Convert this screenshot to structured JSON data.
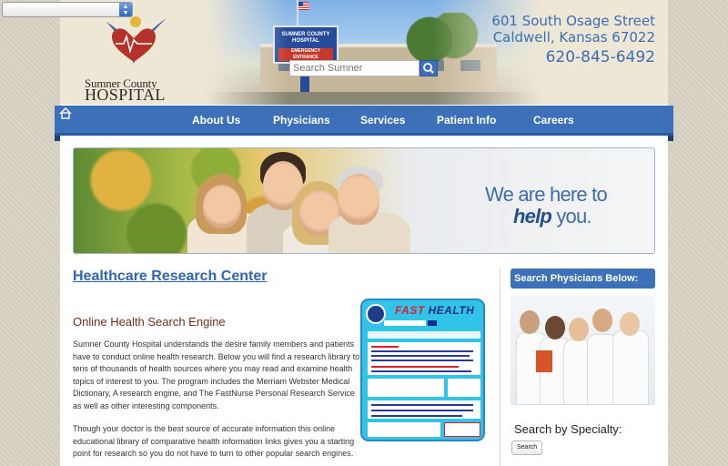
{
  "language_select": {
    "value": ""
  },
  "header": {
    "logo_line1": "Sumner County",
    "logo_line2": "HOSPITAL",
    "search_placeholder": "Search Sumner",
    "sign_title": "SUMNER COUNTY HOSPITAL",
    "sign_er": "EMERGENCY ENTRANCE",
    "address_line1": "601 South Osage Street",
    "address_line2": "Caldwell, Kansas 67022",
    "phone": "620-845-6492"
  },
  "nav": {
    "items": [
      {
        "label": "About Us"
      },
      {
        "label": "Physicians"
      },
      {
        "label": "Services"
      },
      {
        "label": "Patient Info"
      },
      {
        "label": "Careers"
      }
    ]
  },
  "banner": {
    "tagline_line1": "We are here to",
    "tagline_help": "help",
    "tagline_end": " you."
  },
  "main": {
    "title": "Healthcare Research Center",
    "subtitle": "Online Health Search Engine",
    "paragraph1": "Sumner County Hospital understands the desire family members and patients have to conduct online health research. Below you will find a research library to tens of thousands of health sources where you may read and examine health topics of interest to you. The program includes the Merriam Webster Medical Dictionary, A research engine, and The FastNurse Personal Research Service as well as other interesting components.",
    "paragraph2": "Though your doctor is the best source of accurate information this online educational library of comparative health information links gives you a starting point for research so you do not have to turn to other popular search engines."
  },
  "fasthealth": {
    "logo_fast": "FAST",
    "logo_health": " HEALTH"
  },
  "sidebar": {
    "heading": "Search Physicians Below:",
    "subheading": "Search by Specialty:",
    "button": "Search"
  },
  "colors": {
    "brand_blue": "#3c70b8",
    "link_blue": "#2f65b4",
    "contact_blue": "#3a6db4",
    "subtitle_brown": "#6f2d1b",
    "logo_red": "#b5322a"
  }
}
